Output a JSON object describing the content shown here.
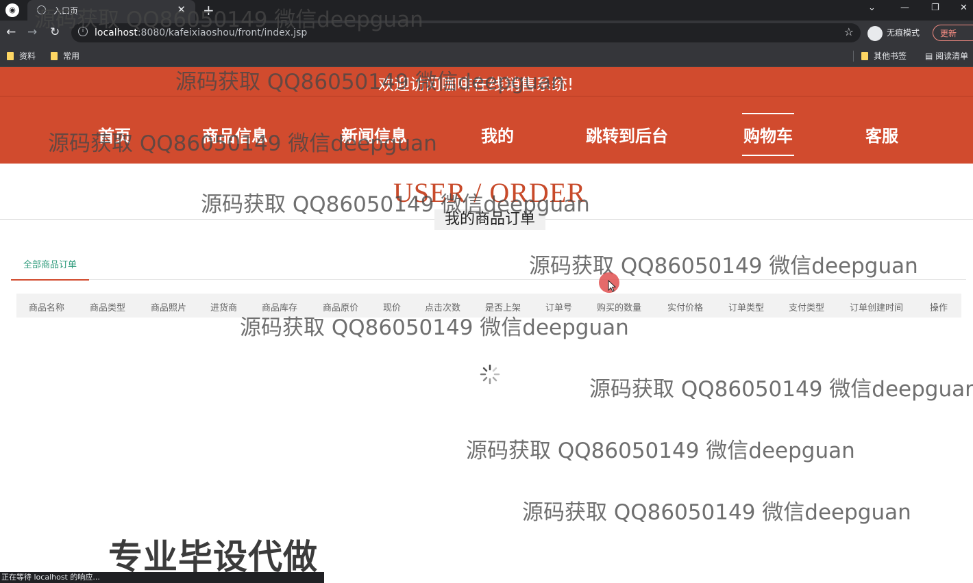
{
  "browser": {
    "tab_title": "入口页",
    "url_host": "localhost",
    "url_rest": ":8080/kafeixiaoshou/front/index.jsp",
    "incognito_label": "无痕模式",
    "update_label": "更新",
    "bookmarks": [
      "资料",
      "常用"
    ],
    "other_bookmarks": "其他书签",
    "reading_list": "阅读清单",
    "status_text": "正在等待 localhost 的响应..."
  },
  "page": {
    "welcome": "欢迎访问咖啡在线销售系统!",
    "nav": [
      "首页",
      "商品信息",
      "新闻信息",
      "我的",
      "跳转到后台",
      "购物车",
      "客服"
    ],
    "active_nav": "购物车",
    "section_en": "USER / ORDER",
    "section_cn": "我的商品订单",
    "tab_label": "全部商品订单",
    "columns": [
      "商品名称",
      "商品类型",
      "商品照片",
      "进货商",
      "商品库存",
      "商品原价",
      "现价",
      "点击次数",
      "是否上架",
      "订单号",
      "购买的数量",
      "实付价格",
      "订单类型",
      "支付类型",
      "订单创建时间",
      "操作"
    ]
  },
  "overlays": {
    "watermark": "源码获取 QQ86050149 微信deepguan",
    "promo": "专业毕设代做"
  },
  "colors": {
    "brand": "#d14b2e",
    "accent_tab": "#2c9a7a"
  }
}
